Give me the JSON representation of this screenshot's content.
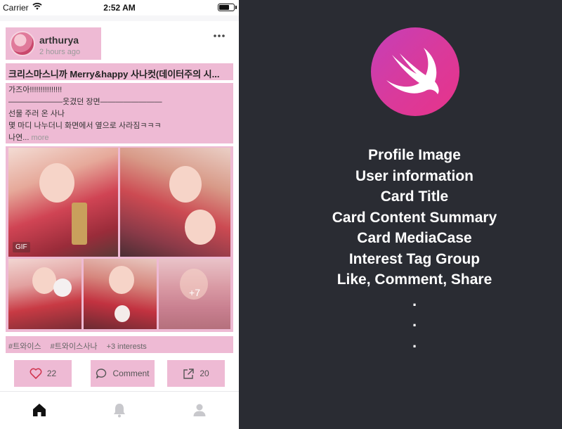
{
  "status_bar": {
    "carrier": "Carrier",
    "time": "2:52 AM"
  },
  "post": {
    "username": "arthurya",
    "time_ago": "2 hours ago",
    "more_icon": "ellipsis-icon",
    "title": "크리스마스니까 Merry&happy 사나컷(데이터주의 시...",
    "content_lines": [
      "가즈아!!!!!!!!!!!!!!!",
      "———————웃겼던 장면————————",
      "선물 주러 온 사나",
      "몇 마디 나누더니 화면에서 옆으로 사라짐ㅋㅋㅋ"
    ],
    "content_last": "나연...",
    "more_label": "more",
    "media": {
      "gif_label": "GIF",
      "more_count": "+7"
    },
    "tags": [
      "#트와이스",
      "#트와이스사나",
      "+3 interests"
    ],
    "actions": {
      "like_count": "22",
      "comment_label": "Comment",
      "share_count": "20"
    }
  },
  "tab_bar": {
    "items": [
      {
        "icon": "home-icon"
      },
      {
        "icon": "bell-icon"
      },
      {
        "icon": "person-icon"
      }
    ]
  },
  "info_panel": {
    "logo": "swift-logo",
    "items": [
      "Profile Image",
      "User information",
      "Card Title",
      "Card Content Summary",
      "Card MediaCase",
      "Interest Tag Group",
      "Like, Comment, Share"
    ],
    "dots": [
      ".",
      ".",
      "."
    ]
  },
  "colors": {
    "highlight": "#eebad4",
    "dark_background": "#2a2c33",
    "swift_gradient_start": "#c53fb8",
    "swift_gradient_end": "#e7338a"
  }
}
